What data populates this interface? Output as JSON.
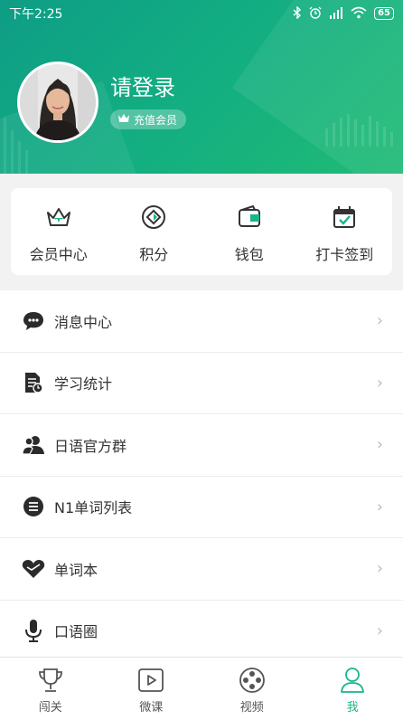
{
  "status_bar": {
    "time": "下午2:25",
    "battery": "65"
  },
  "profile": {
    "login_text": "请登录",
    "vip_label": "充值会员"
  },
  "quick_actions": [
    {
      "label": "会员中心",
      "icon": "crown-icon"
    },
    {
      "label": "积分",
      "icon": "points-icon"
    },
    {
      "label": "钱包",
      "icon": "wallet-icon"
    },
    {
      "label": "打卡签到",
      "icon": "checkin-icon"
    }
  ],
  "menu": [
    {
      "label": "消息中心",
      "icon": "message-icon"
    },
    {
      "label": "学习统计",
      "icon": "statistics-icon"
    },
    {
      "label": "日语官方群",
      "icon": "group-icon"
    },
    {
      "label": "N1单词列表",
      "icon": "list-icon"
    },
    {
      "label": "单词本",
      "icon": "heart-icon"
    },
    {
      "label": "口语圈",
      "icon": "microphone-icon"
    }
  ],
  "bottom_nav": [
    {
      "label": "闯关",
      "icon": "trophy-icon"
    },
    {
      "label": "微课",
      "icon": "play-icon"
    },
    {
      "label": "视频",
      "icon": "film-icon"
    },
    {
      "label": "我",
      "icon": "user-icon",
      "active": true
    }
  ],
  "colors": {
    "accent": "#19b58c",
    "header_start": "#0e9d86",
    "header_end": "#20bb75"
  }
}
